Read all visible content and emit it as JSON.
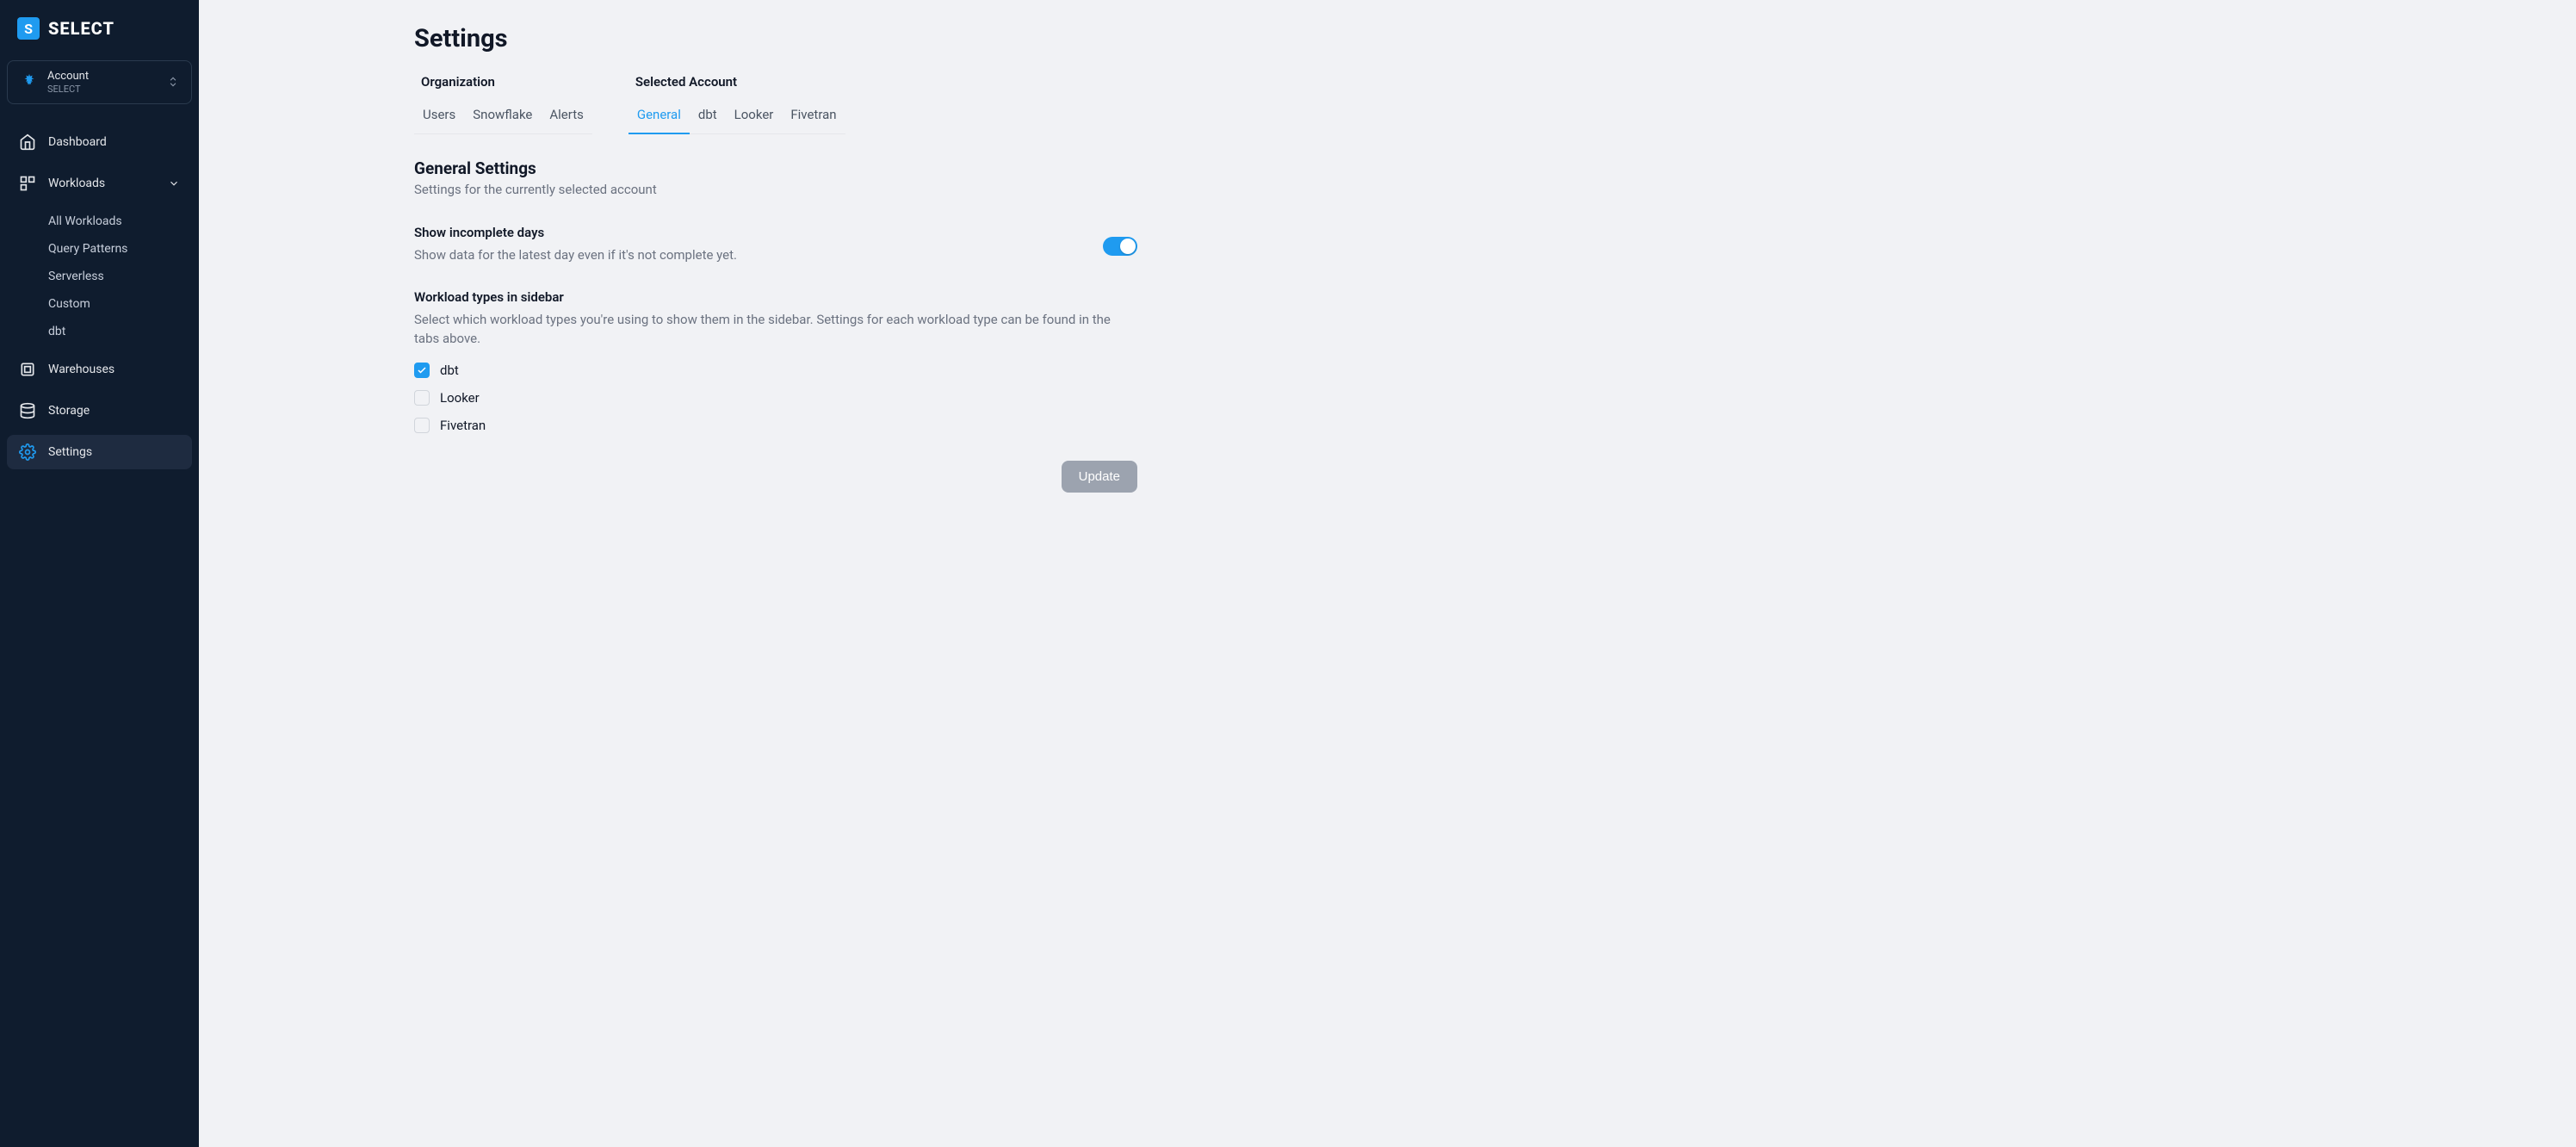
{
  "brand": {
    "name": "SELECT"
  },
  "account": {
    "label": "Account",
    "value": "SELECT"
  },
  "sidebar": {
    "items": [
      {
        "label": "Dashboard",
        "icon": "home-icon"
      },
      {
        "label": "Workloads",
        "icon": "workloads-icon",
        "expanded": true
      },
      {
        "label": "Warehouses",
        "icon": "warehouse-icon"
      },
      {
        "label": "Storage",
        "icon": "storage-icon"
      },
      {
        "label": "Settings",
        "icon": "gear-icon",
        "active": true
      }
    ],
    "workloads_children": [
      {
        "label": "All Workloads"
      },
      {
        "label": "Query Patterns"
      },
      {
        "label": "Serverless"
      },
      {
        "label": "Custom"
      },
      {
        "label": "dbt"
      }
    ]
  },
  "page": {
    "title": "Settings",
    "tab_groups": {
      "organization": {
        "title": "Organization",
        "tabs": [
          {
            "label": "Users"
          },
          {
            "label": "Snowflake"
          },
          {
            "label": "Alerts"
          }
        ]
      },
      "selected_account": {
        "title": "Selected Account",
        "tabs": [
          {
            "label": "General",
            "active": true
          },
          {
            "label": "dbt"
          },
          {
            "label": "Looker"
          },
          {
            "label": "Fivetran"
          }
        ]
      }
    },
    "section": {
      "title": "General Settings",
      "subtitle": "Settings for the currently selected account"
    },
    "settings": {
      "incomplete_days": {
        "title": "Show incomplete days",
        "desc": "Show data for the latest day even if it's not complete yet.",
        "enabled": true
      },
      "workload_types": {
        "title": "Workload types in sidebar",
        "desc": "Select which workload types you're using to show them in the sidebar. Settings for each workload type can be found in the tabs above.",
        "options": [
          {
            "label": "dbt",
            "checked": true
          },
          {
            "label": "Looker",
            "checked": false
          },
          {
            "label": "Fivetran",
            "checked": false
          }
        ]
      }
    },
    "update_label": "Update"
  }
}
